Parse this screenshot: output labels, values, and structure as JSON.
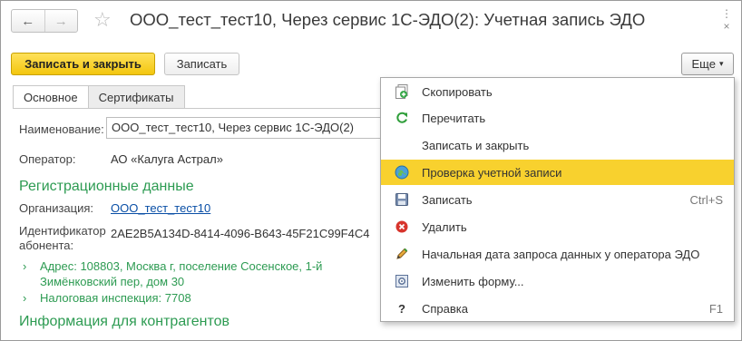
{
  "window": {
    "title": "ООО_тест_тест10, Через сервис 1С-ЭДО(2): Учетная запись ЭДО",
    "back_glyph": "←",
    "forward_glyph": "→",
    "star_glyph": "☆",
    "dots_glyph": "⋮",
    "close_glyph": "×"
  },
  "toolbar": {
    "save_close_label": "Записать и закрыть",
    "save_label": "Записать",
    "more_label": "Еще",
    "more_caret": "▾"
  },
  "tabs": [
    {
      "label": "Основное",
      "active": true
    },
    {
      "label": "Сертификаты",
      "active": false
    }
  ],
  "form": {
    "name_label": "Наименование:",
    "name_value": "ООО_тест_тест10, Через сервис 1С-ЭДО(2)",
    "operator_label": "Оператор:",
    "operator_value": "АО «Калуга Астрал»",
    "reg_section": "Регистрационные данные",
    "org_label": "Организация:",
    "org_value": "ООО_тест_тест10",
    "subscriber_label_1": "Идентификатор",
    "subscriber_label_2": "абонента:",
    "subscriber_value": "2AE2B5A134D-8414-4096-B643-45F21C99F4C4",
    "address_line_1": "Адрес: 108803, Москва г, поселение Сосенское, 1-й",
    "address_line_2": "Зимёнковский пер, дом 30",
    "tax_label": "Налоговая инспекция: 7708",
    "chevron_glyph": "›",
    "contractors_section": "Информация для контрагентов"
  },
  "menu": {
    "items": [
      {
        "label": "Скопировать",
        "icon": "copy-icon",
        "shortcut": ""
      },
      {
        "label": "Перечитать",
        "icon": "refresh-icon",
        "shortcut": ""
      },
      {
        "label": "Записать и закрыть",
        "icon": "",
        "shortcut": ""
      },
      {
        "label": "Проверка учетной записи",
        "icon": "globe-check-icon",
        "shortcut": "",
        "highlighted": true
      },
      {
        "label": "Записать",
        "icon": "save-icon",
        "shortcut": "Ctrl+S"
      },
      {
        "label": "Удалить",
        "icon": "delete-icon",
        "shortcut": ""
      },
      {
        "label": "Начальная дата запроса данных у оператора ЭДО",
        "icon": "pencil-icon",
        "shortcut": ""
      },
      {
        "label": "Изменить форму...",
        "icon": "form-settings-icon",
        "shortcut": ""
      },
      {
        "label": "Справка",
        "icon": "help-icon",
        "icon_glyph": "?",
        "shortcut": "F1"
      }
    ]
  },
  "colors": {
    "accent_yellow": "#f8d12e",
    "section_green": "#2d9b52",
    "link_blue": "#0a4fa6"
  }
}
